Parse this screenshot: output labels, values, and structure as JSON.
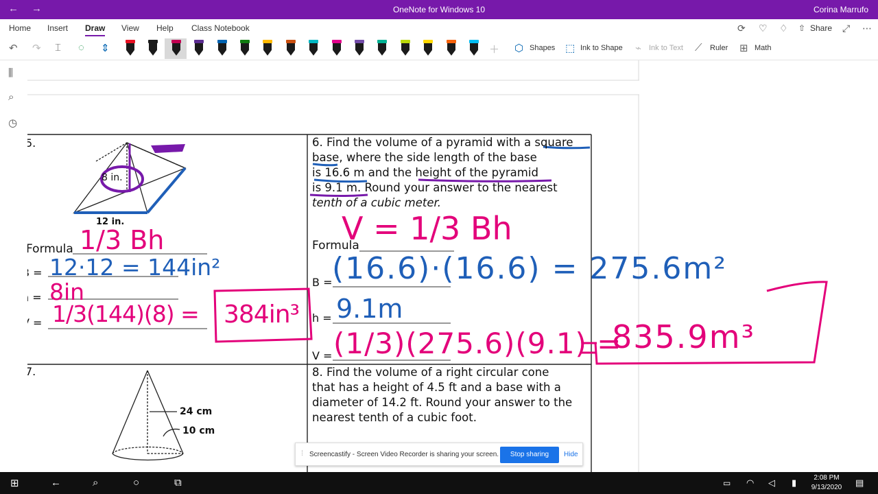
{
  "window": {
    "title": "OneNote for Windows 10",
    "user": "Corina Marrufo",
    "back_glyph": "←",
    "forward_glyph": "→"
  },
  "menu": {
    "tabs": [
      "Home",
      "Insert",
      "Draw",
      "View",
      "Help",
      "Class Notebook"
    ],
    "active": "Draw",
    "share_label": "Share"
  },
  "toolbar": {
    "shapes_label": "Shapes",
    "ink_to_shape_label": "Ink to Shape",
    "ink_to_text_label": "Ink to Text",
    "ruler_label": "Ruler",
    "math_label": "Math",
    "pen_colors": [
      "#e81123",
      "#1a1a1a",
      "#c30052",
      "#5c2d91",
      "#0063b1",
      "#107c10",
      "#ffb900",
      "#ca5010",
      "#00b7c3",
      "#e3008c",
      "#744da9",
      "#00b294",
      "#bad80a",
      "#ffd800",
      "#f7630c",
      "#00bcf2"
    ],
    "accent_color": "#7719aa"
  },
  "worksheet": {
    "problem5_number": "5.",
    "problem5_dims": {
      "height": "8 in.",
      "base": "12 in."
    },
    "problem5_rows": {
      "formula": "Formula",
      "b": "B =",
      "h": "h =",
      "v": "V ="
    },
    "problem6_number": "6.",
    "problem6_text": [
      "Find the volume of a pyramid with a square",
      "base, where the side length of the base",
      "is 16.6 m and the height of the pyramid",
      "is 9.1 m. Round your answer to the nearest",
      "tenth of a cubic meter."
    ],
    "problem6_rows": {
      "formula": "Formula",
      "b": "B =",
      "h": "h =",
      "v": "V ="
    },
    "problem7_number": "7.",
    "problem7_dims": {
      "height": "24 cm",
      "radius": "10 cm"
    },
    "problem8_number": "8.",
    "problem8_text": [
      "Find the volume of a right circular cone",
      "that has a height of 4.5 ft and a base with a",
      "diameter of 14.2 ft. Round your answer to the",
      "nearest tenth of a cubic foot."
    ]
  },
  "ink": {
    "p5_formula": "1/3 Bh",
    "p5_b": "12·12 = 144in²",
    "p5_h": "8in",
    "p5_v": "1/3(144)(8) =",
    "p5_answer": "384in³",
    "p6_formula": "V = 1/3 Bh",
    "p6_b": "(16.6)·(16.6) = 275.6m²",
    "p6_h": "9.1m",
    "p6_v": "(1/3)(275.6)(9.1) =",
    "p6_answer": "835.9m³",
    "colors": {
      "pink": "#e3007a",
      "blue": "#1f5fb8",
      "purple": "#7719aa"
    }
  },
  "screen_share": {
    "message": "Screencastify - Screen Video Recorder is sharing your screen.",
    "stop_label": "Stop sharing",
    "hide_label": "Hide"
  },
  "taskbar": {
    "time": "2:08 PM",
    "date": "9/13/2020"
  }
}
